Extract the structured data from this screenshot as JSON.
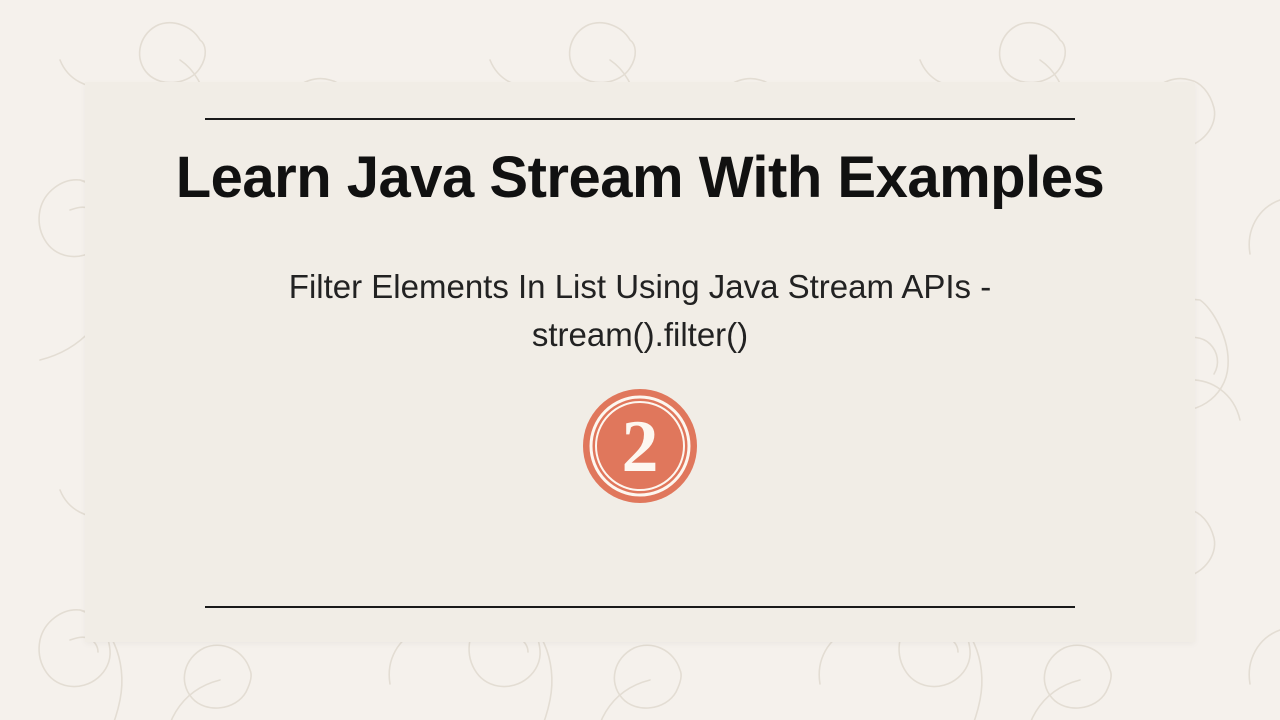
{
  "colors": {
    "page_bg": "#f5f1ec",
    "card_bg": "#f1ede6",
    "text": "#111111",
    "rule": "#1a1a1a",
    "accent": "#e0775c",
    "badge_text": "#fdf7f0",
    "floral_stroke": "#b5a894"
  },
  "content": {
    "title": "Learn Java Stream With Examples",
    "subtitle": "Filter Elements In List Using Java Stream APIs - stream().filter()",
    "badge_number": "2"
  }
}
